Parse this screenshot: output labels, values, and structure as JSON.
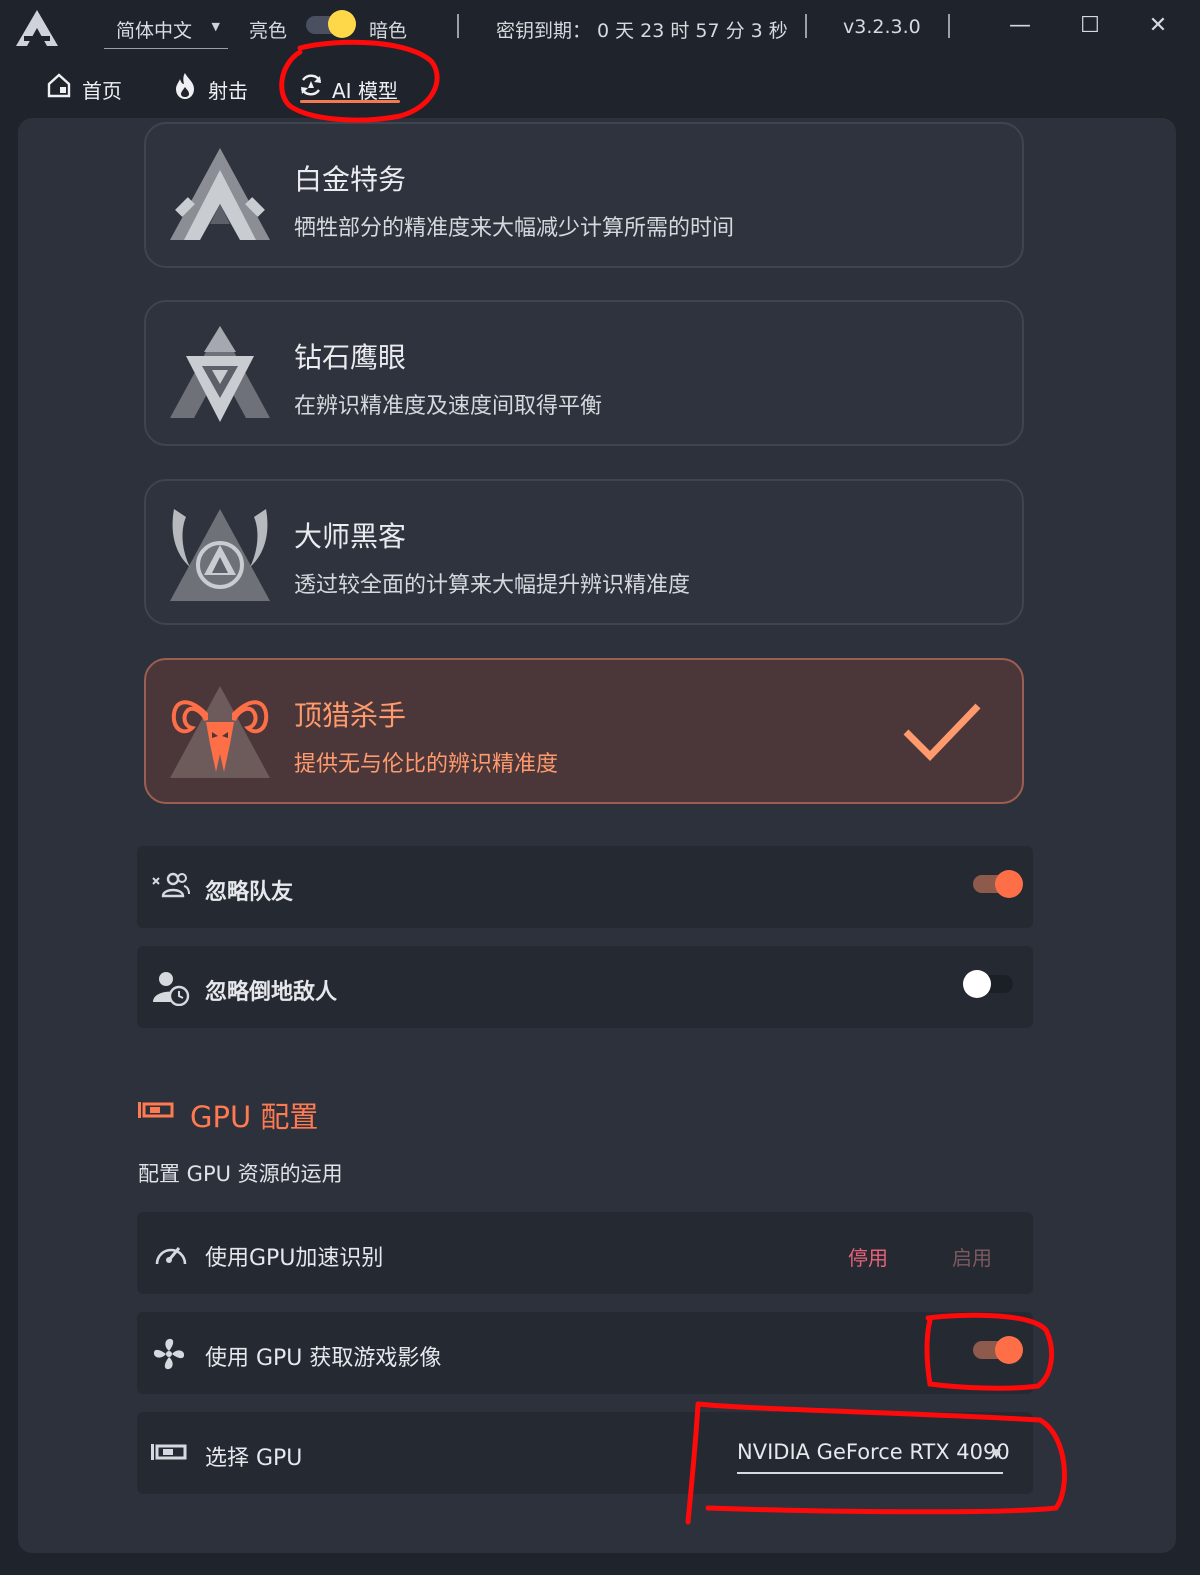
{
  "titlebar": {
    "language": "简体中文",
    "theme_light_label": "亮色",
    "theme_dark_label": "暗色",
    "key_expiry_label": "密钥到期：",
    "key_expiry_value": "0 天 23 时 57 分 3 秒",
    "version": "v3.2.3.0",
    "minimize_glyph": "—",
    "maximize_glyph": "☐",
    "close_glyph": "✕"
  },
  "nav": {
    "tabs": [
      {
        "label": "首页",
        "icon": "home-icon"
      },
      {
        "label": "射击",
        "icon": "flame-icon"
      },
      {
        "label": "AI 模型",
        "icon": "ai-model-icon",
        "active": true
      }
    ]
  },
  "models": [
    {
      "title": "白金特务",
      "desc": "牺牲部分的精准度来大幅减少计算所需的时间",
      "selected": false,
      "icon": "platinum-emblem-icon"
    },
    {
      "title": "钻石鹰眼",
      "desc": "在辨识精准度及速度间取得平衡",
      "selected": false,
      "icon": "diamond-emblem-icon"
    },
    {
      "title": "大师黑客",
      "desc": "透过较全面的计算来大幅提升辨识精准度",
      "selected": false,
      "icon": "master-emblem-icon"
    },
    {
      "title": "顶猎杀手",
      "desc": "提供无与伦比的辨识精准度",
      "selected": true,
      "icon": "predator-emblem-icon"
    }
  ],
  "toggles": {
    "ignore_teammates": {
      "label": "忽略队友",
      "on": true
    },
    "ignore_downed": {
      "label": "忽略倒地敌人",
      "on": false
    }
  },
  "gpu": {
    "section_title": "GPU 配置",
    "section_subtitle": "配置 GPU 资源的运用",
    "accel": {
      "label": "使用GPU加速识别",
      "disable_label": "停用",
      "enable_label": "启用"
    },
    "capture": {
      "label": "使用 GPU 获取游戏影像",
      "on": true
    },
    "select": {
      "label": "选择 GPU",
      "value": "NVIDIA GeForce RTX 4090"
    }
  },
  "colors": {
    "accent": "#ff6f47",
    "selected_card_bg": "#4b3739",
    "panel_bg": "#2c313b",
    "annotation_red": "#ff0a0a"
  }
}
